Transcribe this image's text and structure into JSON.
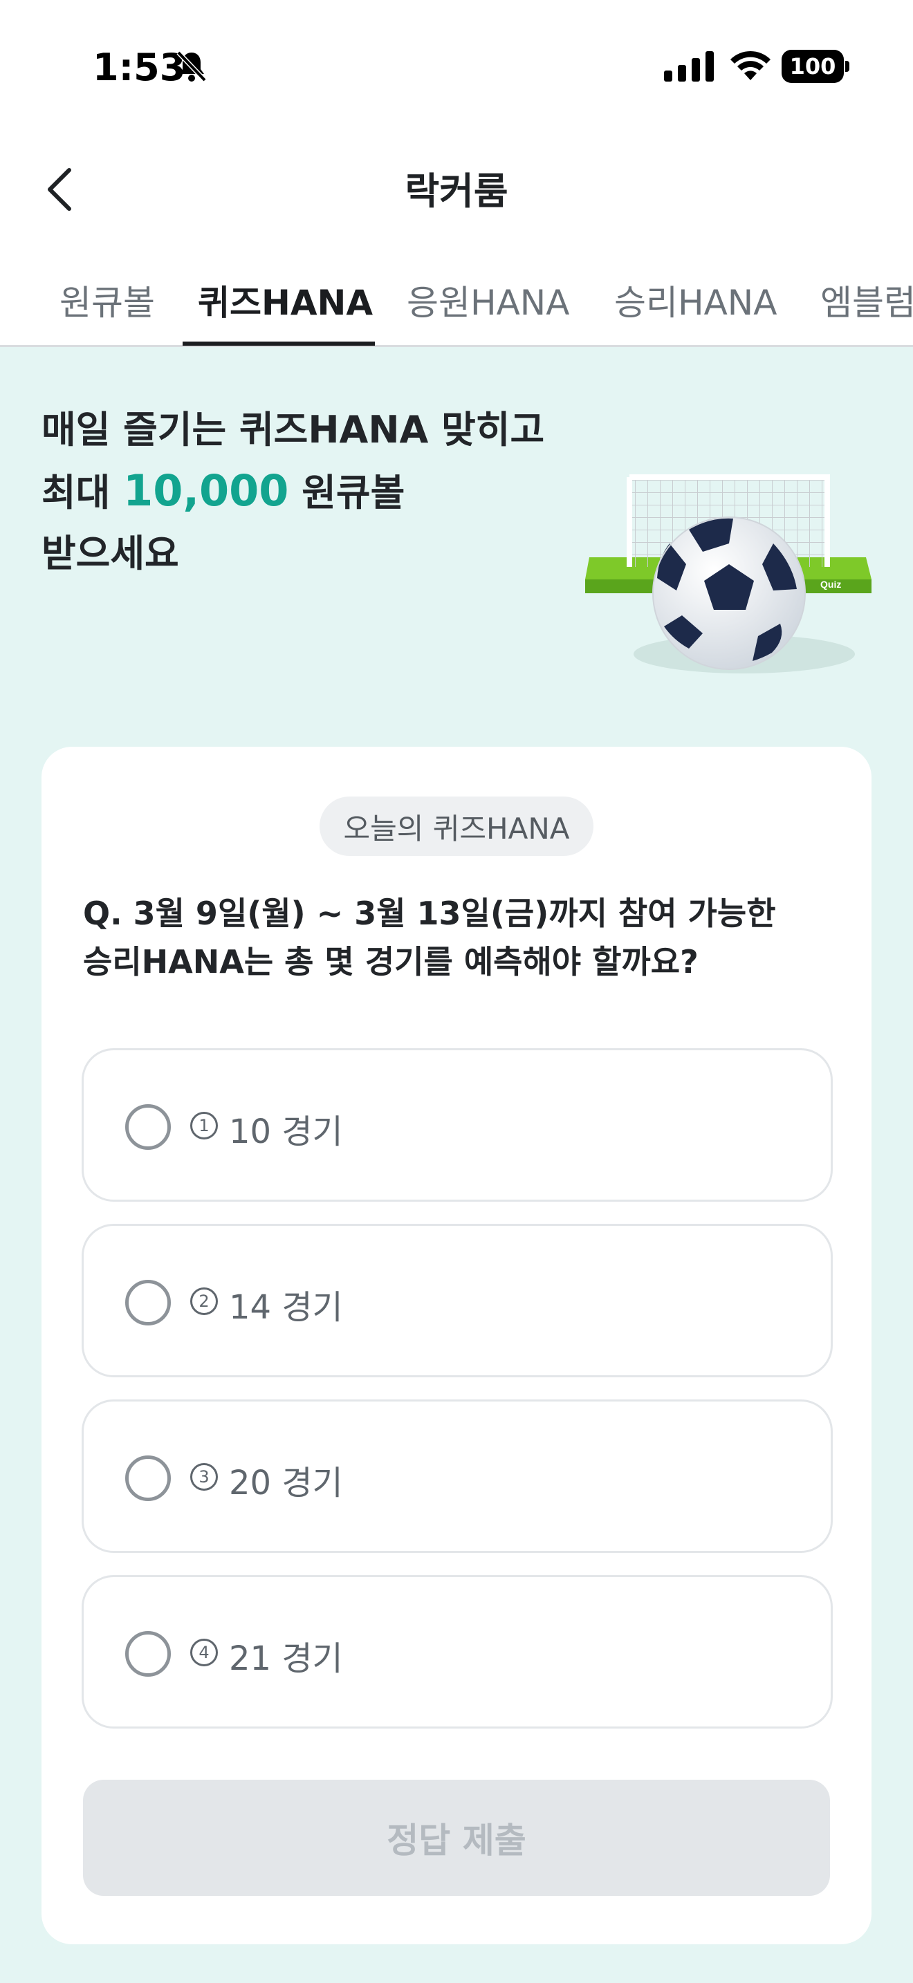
{
  "status_bar": {
    "time": "1:53",
    "battery": "100",
    "icons": [
      "bell-slash-icon",
      "signal-icon",
      "wifi-icon",
      "battery-icon"
    ]
  },
  "header": {
    "title": "락커룸",
    "back_icon": "chevron-left-icon"
  },
  "tabs": [
    {
      "label": "원큐볼",
      "active": false
    },
    {
      "label": "퀴즈HANA",
      "active": true
    },
    {
      "label": "응원HANA",
      "active": false
    },
    {
      "label": "승리HANA",
      "active": false
    },
    {
      "label": "엠블럼",
      "active": false
    }
  ],
  "hero": {
    "line1": "매일 즐기는 퀴즈HANA 맞히고",
    "line2_prefix": "최대 ",
    "line2_highlight": "10,000",
    "line2_suffix": " 원큐볼",
    "line3": "받으세요",
    "illustration_label": "Quiz",
    "illustration_icon": "soccer-ball-goal-icon"
  },
  "quiz": {
    "badge": "오늘의 퀴즈HANA",
    "question_line1": "Q. 3월 9일(월) ~ 3월 13일(금)까지 참여 가능한",
    "question_line2": "승리HANA는 총 몇 경기를 예측해야 할까요?",
    "options": [
      {
        "number": "1",
        "label": "10 경기"
      },
      {
        "number": "2",
        "label": "14 경기"
      },
      {
        "number": "3",
        "label": "20 경기"
      },
      {
        "number": "4",
        "label": "21 경기"
      }
    ],
    "submit_label": "정답 제출"
  },
  "colors": {
    "accent": "#12a48f",
    "background": "#e4f5f3",
    "card": "#ffffff",
    "disabled_button": "#e3e6e9"
  }
}
